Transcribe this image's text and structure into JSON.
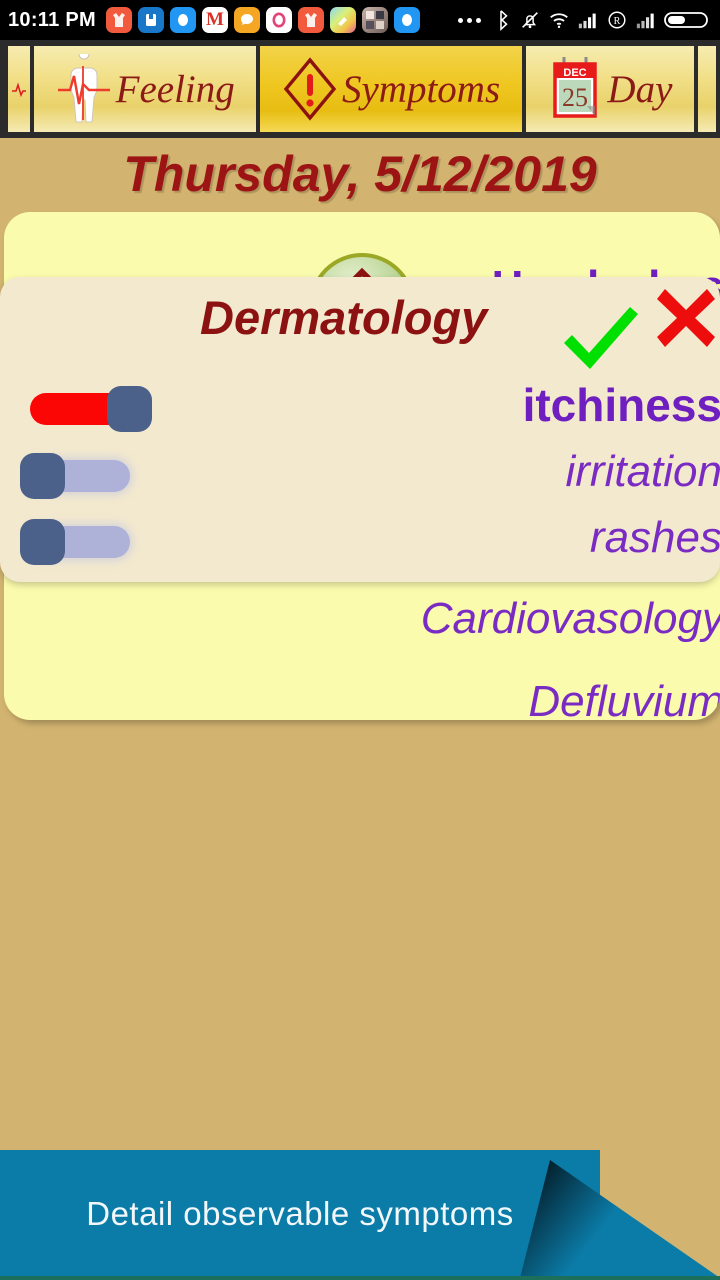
{
  "status_bar": {
    "clock": "10:11 PM",
    "app_icons": [
      {
        "name": "shopping-app-icon",
        "glyph": "\u0001",
        "bg": "#f15a3c",
        "fg": "#ffffff"
      },
      {
        "name": "blue-book-app-icon",
        "glyph": "\u0001",
        "bg": "#1877c9",
        "fg": "#ffffff"
      },
      {
        "name": "messenger-app-icon",
        "glyph": "\u0001",
        "bg": "#2196f3",
        "fg": "#ffffff"
      },
      {
        "name": "gmail-app-icon",
        "glyph": "M",
        "bg": "#ffffff",
        "fg": "#d93025"
      },
      {
        "name": "chat-bubble-app-icon",
        "glyph": "\u0001",
        "bg": "#f5a623",
        "fg": "#ffffff"
      },
      {
        "name": "opera-app-icon",
        "glyph": "O",
        "bg": "#ffffff",
        "fg": "#e0457b"
      },
      {
        "name": "shopping-app-icon-2",
        "glyph": "\u0001",
        "bg": "#f15a3c",
        "fg": "#ffffff"
      },
      {
        "name": "gallery-app-icon",
        "glyph": "\u0001",
        "bg": "#7ec8e3",
        "fg": "#ffffff"
      },
      {
        "name": "photos-collage-app-icon",
        "glyph": "\u0001",
        "bg": "#b8a7a0",
        "fg": "#ffffff"
      },
      {
        "name": "messenger-app-icon-2",
        "glyph": "\u0001",
        "bg": "#2196f3",
        "fg": "#ffffff"
      }
    ],
    "system_icons": [
      "overflow-dots-icon",
      "bluetooth-icon",
      "mute-bell-icon",
      "wifi-icon",
      "signal-bars-icon",
      "roaming-icon",
      "signal-bars-2-icon",
      "battery-icon"
    ]
  },
  "tabs": [
    {
      "label": "",
      "icon": "partial-tab",
      "active": false
    },
    {
      "label": "Feeling",
      "icon": "body-pulse-icon",
      "active": false
    },
    {
      "label": "Symptoms",
      "icon": "warning-diamond-icon",
      "active": true
    },
    {
      "label": "Day",
      "icon": "calendar-icon",
      "active": false
    },
    {
      "label": "",
      "icon": "partial-tab",
      "active": false
    }
  ],
  "calendar_icon": {
    "month": "DEC",
    "day": "25"
  },
  "date_header": "Thursday, 5/12/2019",
  "symptom_card": {
    "categories": [
      {
        "label": "Headaches",
        "bold": true,
        "icon": "warning-circle-icon"
      },
      {
        "label": "Dermatology",
        "bold": true,
        "icon": null
      },
      {
        "label": "Cardiovasology",
        "bold": false,
        "icon": null
      },
      {
        "label": "Defluvium",
        "bold": false,
        "icon": null
      }
    ]
  },
  "dialog": {
    "title": "Dermatology",
    "accept_icon": "green-check-icon",
    "cancel_icon": "red-x-icon",
    "accept_color": "#00e000",
    "cancel_color": "#ee0d0d",
    "rows": [
      {
        "label": "itchiness",
        "on": true,
        "bold": true
      },
      {
        "label": "irritation",
        "on": false,
        "bold": false
      },
      {
        "label": "rashes",
        "on": false,
        "bold": false
      }
    ]
  },
  "bottom_banner": {
    "text": "Detail observable symptoms",
    "color": "#0b7ca8"
  },
  "colors": {
    "background": "#d2b470",
    "card": "#fbfbad",
    "dialog": "#f3e9cf",
    "accent_purple": "#7a2bc4",
    "accent_dark_red": "#8c1212",
    "toggle_on": "#fb0505",
    "toggle_off": "#aeb2d8",
    "toggle_knob": "#4b6189"
  }
}
